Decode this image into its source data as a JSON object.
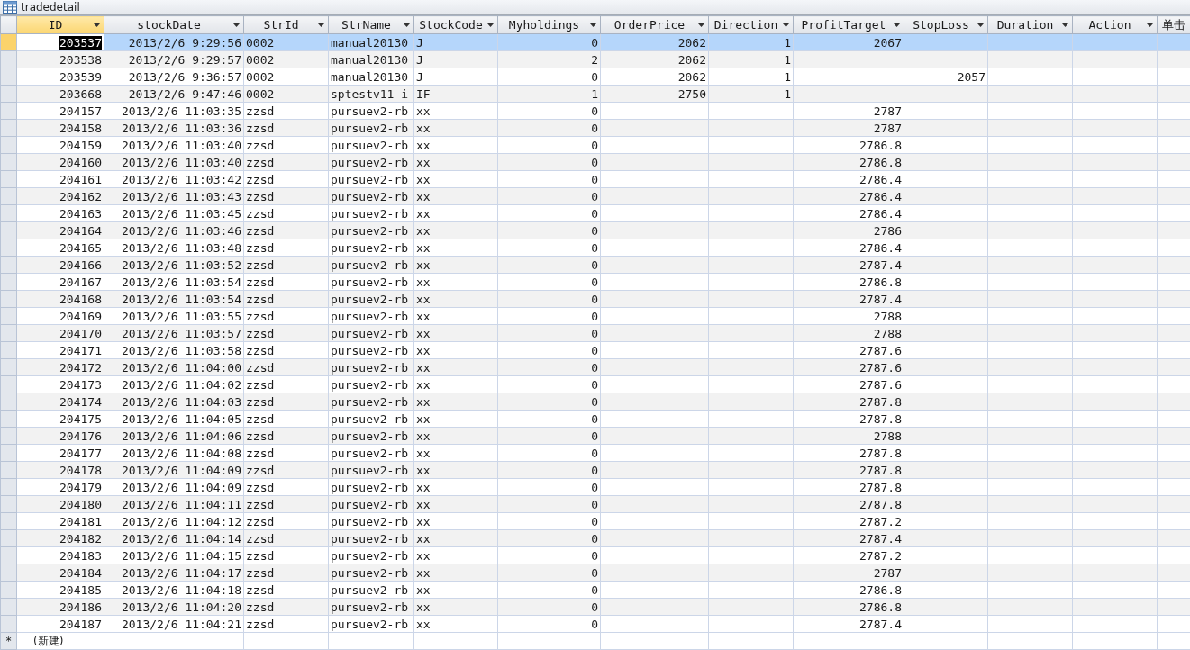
{
  "window": {
    "title": "tradedetail"
  },
  "table": {
    "columns": [
      {
        "label": "ID",
        "kind": "number",
        "selected": true
      },
      {
        "label": "stockDate",
        "kind": "number",
        "selected": false
      },
      {
        "label": "StrId",
        "kind": "text",
        "selected": false
      },
      {
        "label": "StrName",
        "kind": "text",
        "selected": false
      },
      {
        "label": "StockCode",
        "kind": "text",
        "selected": false
      },
      {
        "label": "Myholdings",
        "kind": "number",
        "selected": false
      },
      {
        "label": "OrderPrice",
        "kind": "number",
        "selected": false
      },
      {
        "label": "Direction",
        "kind": "number",
        "selected": false
      },
      {
        "label": "ProfitTarget",
        "kind": "number",
        "selected": false
      },
      {
        "label": "StopLoss",
        "kind": "number",
        "selected": false
      },
      {
        "label": "Duration",
        "kind": "number",
        "selected": false
      },
      {
        "label": "Action",
        "kind": "number",
        "selected": false
      },
      {
        "label": "单击",
        "kind": "text",
        "selected": false
      }
    ],
    "rows": [
      {
        "selected": true,
        "cells": [
          "203537",
          "2013/2/6 9:29:56",
          "0002",
          "manual20130",
          "J",
          "0",
          "2062",
          "1",
          "2067"
        ]
      },
      {
        "selected": false,
        "cells": [
          "203538",
          "2013/2/6 9:29:57",
          "0002",
          "manual20130",
          "J",
          "2",
          "2062",
          "1"
        ]
      },
      {
        "selected": false,
        "cells": [
          "203539",
          "2013/2/6 9:36:57",
          "0002",
          "manual20130",
          "J",
          "0",
          "2062",
          "1",
          null,
          "2057"
        ]
      },
      {
        "selected": false,
        "cells": [
          "203668",
          "2013/2/6 9:47:46",
          "0002",
          "sptestv11-i",
          "IF",
          "1",
          "2750",
          "1"
        ]
      },
      {
        "selected": false,
        "cells": [
          "204157",
          "2013/2/6 11:03:35",
          "zzsd",
          "pursuev2-rb",
          "xx",
          "0",
          null,
          null,
          "2787"
        ]
      },
      {
        "selected": false,
        "cells": [
          "204158",
          "2013/2/6 11:03:36",
          "zzsd",
          "pursuev2-rb",
          "xx",
          "0",
          null,
          null,
          "2787"
        ]
      },
      {
        "selected": false,
        "cells": [
          "204159",
          "2013/2/6 11:03:40",
          "zzsd",
          "pursuev2-rb",
          "xx",
          "0",
          null,
          null,
          "2786.8"
        ]
      },
      {
        "selected": false,
        "cells": [
          "204160",
          "2013/2/6 11:03:40",
          "zzsd",
          "pursuev2-rb",
          "xx",
          "0",
          null,
          null,
          "2786.8"
        ]
      },
      {
        "selected": false,
        "cells": [
          "204161",
          "2013/2/6 11:03:42",
          "zzsd",
          "pursuev2-rb",
          "xx",
          "0",
          null,
          null,
          "2786.4"
        ]
      },
      {
        "selected": false,
        "cells": [
          "204162",
          "2013/2/6 11:03:43",
          "zzsd",
          "pursuev2-rb",
          "xx",
          "0",
          null,
          null,
          "2786.4"
        ]
      },
      {
        "selected": false,
        "cells": [
          "204163",
          "2013/2/6 11:03:45",
          "zzsd",
          "pursuev2-rb",
          "xx",
          "0",
          null,
          null,
          "2786.4"
        ]
      },
      {
        "selected": false,
        "cells": [
          "204164",
          "2013/2/6 11:03:46",
          "zzsd",
          "pursuev2-rb",
          "xx",
          "0",
          null,
          null,
          "2786"
        ]
      },
      {
        "selected": false,
        "cells": [
          "204165",
          "2013/2/6 11:03:48",
          "zzsd",
          "pursuev2-rb",
          "xx",
          "0",
          null,
          null,
          "2786.4"
        ]
      },
      {
        "selected": false,
        "cells": [
          "204166",
          "2013/2/6 11:03:52",
          "zzsd",
          "pursuev2-rb",
          "xx",
          "0",
          null,
          null,
          "2787.4"
        ]
      },
      {
        "selected": false,
        "cells": [
          "204167",
          "2013/2/6 11:03:54",
          "zzsd",
          "pursuev2-rb",
          "xx",
          "0",
          null,
          null,
          "2786.8"
        ]
      },
      {
        "selected": false,
        "cells": [
          "204168",
          "2013/2/6 11:03:54",
          "zzsd",
          "pursuev2-rb",
          "xx",
          "0",
          null,
          null,
          "2787.4"
        ]
      },
      {
        "selected": false,
        "cells": [
          "204169",
          "2013/2/6 11:03:55",
          "zzsd",
          "pursuev2-rb",
          "xx",
          "0",
          null,
          null,
          "2788"
        ]
      },
      {
        "selected": false,
        "cells": [
          "204170",
          "2013/2/6 11:03:57",
          "zzsd",
          "pursuev2-rb",
          "xx",
          "0",
          null,
          null,
          "2788"
        ]
      },
      {
        "selected": false,
        "cells": [
          "204171",
          "2013/2/6 11:03:58",
          "zzsd",
          "pursuev2-rb",
          "xx",
          "0",
          null,
          null,
          "2787.6"
        ]
      },
      {
        "selected": false,
        "cells": [
          "204172",
          "2013/2/6 11:04:00",
          "zzsd",
          "pursuev2-rb",
          "xx",
          "0",
          null,
          null,
          "2787.6"
        ]
      },
      {
        "selected": false,
        "cells": [
          "204173",
          "2013/2/6 11:04:02",
          "zzsd",
          "pursuev2-rb",
          "xx",
          "0",
          null,
          null,
          "2787.6"
        ]
      },
      {
        "selected": false,
        "cells": [
          "204174",
          "2013/2/6 11:04:03",
          "zzsd",
          "pursuev2-rb",
          "xx",
          "0",
          null,
          null,
          "2787.8"
        ]
      },
      {
        "selected": false,
        "cells": [
          "204175",
          "2013/2/6 11:04:05",
          "zzsd",
          "pursuev2-rb",
          "xx",
          "0",
          null,
          null,
          "2787.8"
        ]
      },
      {
        "selected": false,
        "cells": [
          "204176",
          "2013/2/6 11:04:06",
          "zzsd",
          "pursuev2-rb",
          "xx",
          "0",
          null,
          null,
          "2788"
        ]
      },
      {
        "selected": false,
        "cells": [
          "204177",
          "2013/2/6 11:04:08",
          "zzsd",
          "pursuev2-rb",
          "xx",
          "0",
          null,
          null,
          "2787.8"
        ]
      },
      {
        "selected": false,
        "cells": [
          "204178",
          "2013/2/6 11:04:09",
          "zzsd",
          "pursuev2-rb",
          "xx",
          "0",
          null,
          null,
          "2787.8"
        ]
      },
      {
        "selected": false,
        "cells": [
          "204179",
          "2013/2/6 11:04:09",
          "zzsd",
          "pursuev2-rb",
          "xx",
          "0",
          null,
          null,
          "2787.8"
        ]
      },
      {
        "selected": false,
        "cells": [
          "204180",
          "2013/2/6 11:04:11",
          "zzsd",
          "pursuev2-rb",
          "xx",
          "0",
          null,
          null,
          "2787.8"
        ]
      },
      {
        "selected": false,
        "cells": [
          "204181",
          "2013/2/6 11:04:12",
          "zzsd",
          "pursuev2-rb",
          "xx",
          "0",
          null,
          null,
          "2787.2"
        ]
      },
      {
        "selected": false,
        "cells": [
          "204182",
          "2013/2/6 11:04:14",
          "zzsd",
          "pursuev2-rb",
          "xx",
          "0",
          null,
          null,
          "2787.4"
        ]
      },
      {
        "selected": false,
        "cells": [
          "204183",
          "2013/2/6 11:04:15",
          "zzsd",
          "pursuev2-rb",
          "xx",
          "0",
          null,
          null,
          "2787.2"
        ]
      },
      {
        "selected": false,
        "cells": [
          "204184",
          "2013/2/6 11:04:17",
          "zzsd",
          "pursuev2-rb",
          "xx",
          "0",
          null,
          null,
          "2787"
        ]
      },
      {
        "selected": false,
        "cells": [
          "204185",
          "2013/2/6 11:04:18",
          "zzsd",
          "pursuev2-rb",
          "xx",
          "0",
          null,
          null,
          "2786.8"
        ]
      },
      {
        "selected": false,
        "cells": [
          "204186",
          "2013/2/6 11:04:20",
          "zzsd",
          "pursuev2-rb",
          "xx",
          "0",
          null,
          null,
          "2786.8"
        ]
      },
      {
        "selected": false,
        "cells": [
          "204187",
          "2013/2/6 11:04:21",
          "zzsd",
          "pursuev2-rb",
          "xx",
          "0",
          null,
          null,
          "2787.4"
        ]
      }
    ],
    "new_row": {
      "marker": "*",
      "label": "(新建)"
    }
  }
}
